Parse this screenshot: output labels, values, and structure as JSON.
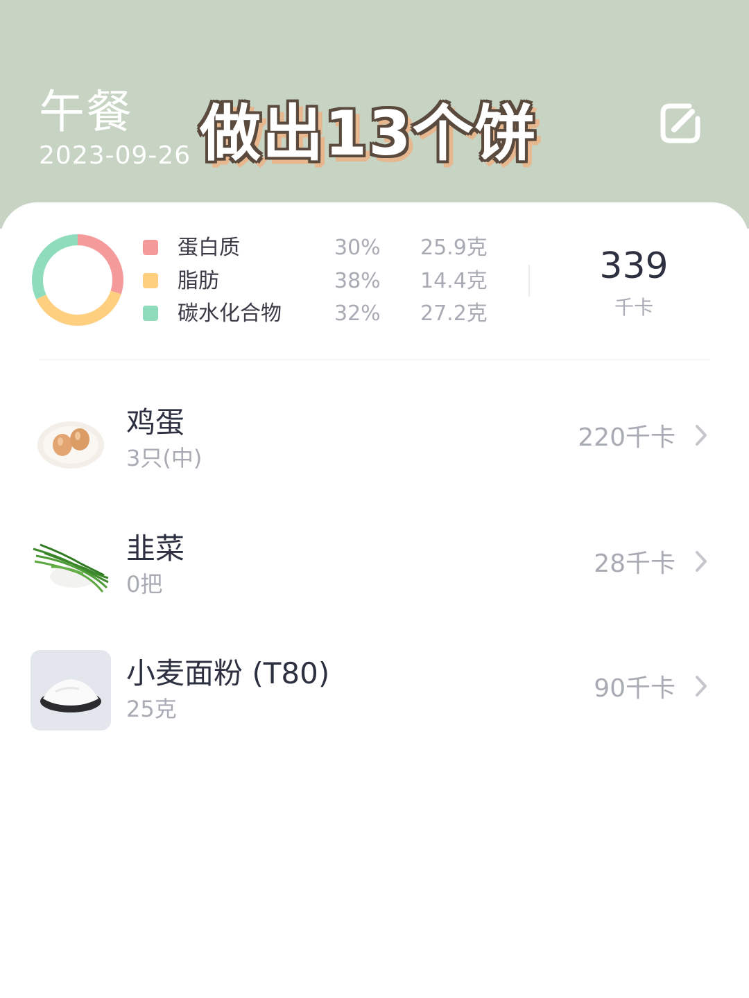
{
  "header": {
    "meal_title": "午餐",
    "date": "2023-09-26",
    "overlay_caption": "做出13个饼",
    "edit_icon": "edit-icon",
    "background_color": "#c7d3c3"
  },
  "nutrition": {
    "macros": [
      {
        "name": "蛋白质",
        "percent": "30%",
        "grams": "25.9克",
        "color": "#f49a9a",
        "fraction": 0.3
      },
      {
        "name": "脂肪",
        "percent": "38%",
        "grams": "14.4克",
        "color": "#fdcf7f",
        "fraction": 0.38
      },
      {
        "name": "碳水化合物",
        "percent": "32%",
        "grams": "27.2克",
        "color": "#8fdcbc",
        "fraction": 0.32
      }
    ],
    "total_kcal": "339",
    "kcal_unit": "千卡"
  },
  "foods": [
    {
      "name": "鸡蛋",
      "amount": "3只(中)",
      "kcal": "220千卡",
      "icon": "egg-plate-icon"
    },
    {
      "name": "韭菜",
      "amount": "0把",
      "kcal": "28千卡",
      "icon": "chives-icon"
    },
    {
      "name": "小麦面粉 (T80)",
      "amount": "25克",
      "kcal": "90千卡",
      "icon": "flour-bowl-icon"
    }
  ]
}
